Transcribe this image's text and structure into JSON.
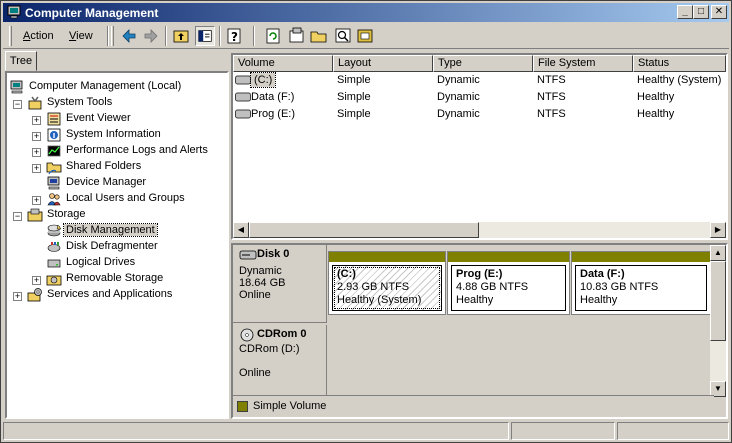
{
  "window": {
    "title": "Computer Management",
    "titlebar_color": "#0a246a",
    "buttons": {
      "minimize": "_",
      "maximize": "□",
      "close": "✕"
    }
  },
  "menu": {
    "action": {
      "hot": "A",
      "rest": "ction"
    },
    "view": {
      "hot": "V",
      "rest": "iew"
    }
  },
  "toolbar_icons": [
    "back-arrow-icon",
    "forward-arrow-icon",
    "up-folder-icon",
    "show-hide-tree-icon",
    "help-icon",
    "refresh-icon",
    "properties-icon",
    "open-icon",
    "search-icon",
    "settings-icon"
  ],
  "tree": {
    "tab_label": "Tree",
    "nodes": [
      {
        "label": "Computer Management (Local)",
        "icon": "computer-icon"
      },
      {
        "label": "System Tools",
        "icon": "tools-icon",
        "expander": "−"
      },
      {
        "label": "Event Viewer",
        "icon": "event-viewer-icon",
        "expander": "+"
      },
      {
        "label": "System Information",
        "icon": "system-info-icon",
        "expander": "+"
      },
      {
        "label": "Performance Logs and Alerts",
        "icon": "performance-icon",
        "expander": "+"
      },
      {
        "label": "Shared Folders",
        "icon": "shared-folder-icon",
        "expander": "+"
      },
      {
        "label": "Device Manager",
        "icon": "device-manager-icon"
      },
      {
        "label": "Local Users and Groups",
        "icon": "users-icon",
        "expander": "+"
      },
      {
        "label": "Storage",
        "icon": "storage-icon",
        "expander": "−"
      },
      {
        "label": "Disk Management",
        "icon": "disk-management-icon",
        "selected": true
      },
      {
        "label": "Disk Defragmenter",
        "icon": "defrag-icon"
      },
      {
        "label": "Logical Drives",
        "icon": "logical-drives-icon"
      },
      {
        "label": "Removable Storage",
        "icon": "removable-storage-icon",
        "expander": "+"
      },
      {
        "label": "Services and Applications",
        "icon": "services-icon",
        "expander": "+"
      }
    ]
  },
  "volume_list": {
    "columns": [
      "Volume",
      "Layout",
      "Type",
      "File System",
      "Status"
    ],
    "rows": [
      {
        "volume": "(C:)",
        "layout": "Simple",
        "type": "Dynamic",
        "fs": "NTFS",
        "status": "Healthy (System)"
      },
      {
        "volume": "Data (F:)",
        "layout": "Simple",
        "type": "Dynamic",
        "fs": "NTFS",
        "status": "Healthy"
      },
      {
        "volume": "Prog (E:)",
        "layout": "Simple",
        "type": "Dynamic",
        "fs": "NTFS",
        "status": "Healthy"
      }
    ]
  },
  "disks": [
    {
      "name": "Disk 0",
      "kind": "Dynamic",
      "size": "18.64 GB",
      "state": "Online",
      "partitions": [
        {
          "name": "(C:)",
          "size": "2.93 GB NTFS",
          "status": "Healthy (System)"
        },
        {
          "name": "Prog  (E:)",
          "size": "4.88 GB NTFS",
          "status": "Healthy"
        },
        {
          "name": "Data  (F:)",
          "size": "10.83 GB NTFS",
          "status": "Healthy"
        }
      ]
    },
    {
      "name": "CDRom 0",
      "kind": "CDRom (D:)",
      "state": "Online"
    }
  ],
  "legend": {
    "label": "Simple Volume",
    "color": "#808000"
  }
}
